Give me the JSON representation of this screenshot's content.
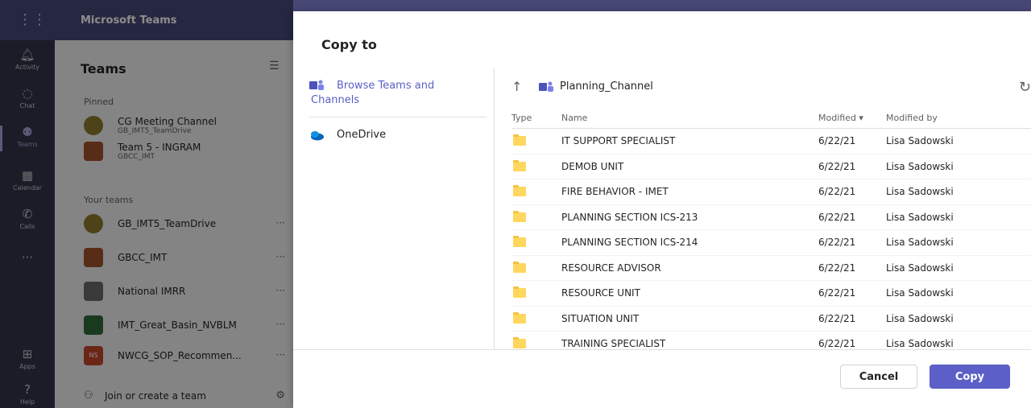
{
  "app": {
    "title": "Microsoft Teams"
  },
  "rail": {
    "items": [
      {
        "label": "Activity",
        "icon": "bell-icon"
      },
      {
        "label": "Chat",
        "icon": "chat-icon"
      },
      {
        "label": "Teams",
        "icon": "teams-icon"
      },
      {
        "label": "Calendar",
        "icon": "calendar-icon"
      },
      {
        "label": "Calls",
        "icon": "phone-icon"
      },
      {
        "label": "Apps",
        "icon": "apps-icon"
      },
      {
        "label": "Help",
        "icon": "help-icon"
      }
    ],
    "more": "···"
  },
  "teams_panel": {
    "title": "Teams",
    "pinned_label": "Pinned",
    "pinned": [
      {
        "name": "CG Meeting Channel",
        "sub": "GB_IMT5_TeamDrive"
      },
      {
        "name": "Team 5 - INGRAM",
        "sub": "GBCC_IMT"
      }
    ],
    "your_teams_label": "Your teams",
    "teams": [
      {
        "name": "GB_IMT5_TeamDrive",
        "more": "···"
      },
      {
        "name": "GBCC_IMT",
        "more": "···"
      },
      {
        "name": "National IMRR",
        "more": "···"
      },
      {
        "name": "IMT_Great_Basin_NVBLM",
        "more": "···"
      },
      {
        "name": "NWCG_SOP_Recommen...",
        "more": "···",
        "badge": "NS"
      }
    ],
    "join_label": "Join or create a team"
  },
  "dialog": {
    "title": "Copy to",
    "locations": {
      "browse_line1": "Browse Teams and",
      "browse_line2": "Channels",
      "onedrive": "OneDrive"
    },
    "breadcrumb": "Planning_Channel",
    "columns": {
      "type": "Type",
      "name": "Name",
      "modified": "Modified ▾",
      "modified_by": "Modified by"
    },
    "rows": [
      {
        "name": "IT SUPPORT SPECIALIST",
        "modified": "6/22/21",
        "modified_by": "Lisa Sadowski"
      },
      {
        "name": "DEMOB UNIT",
        "modified": "6/22/21",
        "modified_by": "Lisa Sadowski"
      },
      {
        "name": "FIRE BEHAVIOR - IMET",
        "modified": "6/22/21",
        "modified_by": "Lisa Sadowski"
      },
      {
        "name": "PLANNING SECTION ICS-213",
        "modified": "6/22/21",
        "modified_by": "Lisa Sadowski"
      },
      {
        "name": "PLANNING SECTION ICS-214",
        "modified": "6/22/21",
        "modified_by": "Lisa Sadowski"
      },
      {
        "name": "RESOURCE ADVISOR",
        "modified": "6/22/21",
        "modified_by": "Lisa Sadowski"
      },
      {
        "name": "RESOURCE UNIT",
        "modified": "6/22/21",
        "modified_by": "Lisa Sadowski"
      },
      {
        "name": "SITUATION UNIT",
        "modified": "6/22/21",
        "modified_by": "Lisa Sadowski"
      },
      {
        "name": "TRAINING SPECIALIST",
        "modified": "6/22/21",
        "modified_by": "Lisa Sadowski"
      }
    ],
    "cancel_label": "Cancel",
    "copy_label": "Copy"
  },
  "colors": {
    "accent": "#5b5fc7",
    "topbar": "#464775",
    "rail": "#33344a",
    "folder": "#ffd75e"
  }
}
